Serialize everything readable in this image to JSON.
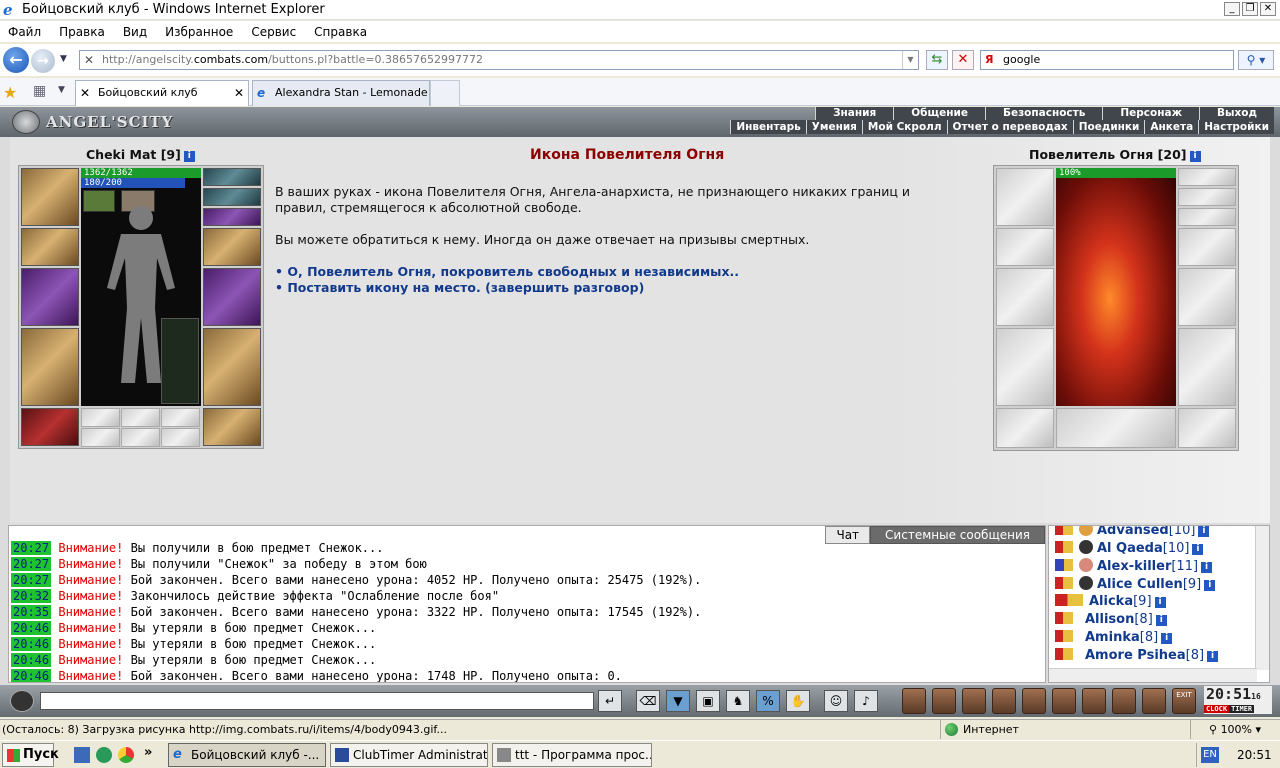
{
  "window": {
    "title": "Бойцовский клуб - Windows Internet Explorer"
  },
  "menu": [
    "Файл",
    "Правка",
    "Вид",
    "Избранное",
    "Сервис",
    "Справка"
  ],
  "address": {
    "url_prefix": "http://angelscity.",
    "url_host": "combats.com",
    "url_suffix": "/buttons.pl?battle=0.38657652997772",
    "search_value": "google"
  },
  "tabs": [
    {
      "label": "Бойцовский клуб"
    },
    {
      "label": "Alexandra Stan - Lemonade ..."
    }
  ],
  "game": {
    "logo": "ANGEL'SCITY",
    "top_menu": [
      "Знания",
      "Общение",
      "Безопасность",
      "Персонаж",
      "Выход"
    ],
    "sub_menu": [
      "Инвентарь",
      "Умения",
      "Мой Скролл",
      "Отчет о переводах",
      "Поединки",
      "Анкета",
      "Настройки"
    ],
    "player": {
      "name": "Cheki Mat",
      "level": "[9]",
      "hp": "1362/1362",
      "mana": "180/200"
    },
    "dialog": {
      "title": "Икона Повелителя Огня",
      "para1": "В ваших руках - икона Повелителя Огня, Ангела-анархиста, не признающего никаких границ и правил, стремящегося к абсолютной свободе.",
      "para2": "Вы можете обратиться к нему. Иногда он даже отвечает на призывы смертных.",
      "option1": "• О, Повелитель Огня, покровитель свободных и независимых..",
      "option2": "• Поставить икону на место. (завершить разговор)"
    },
    "npc": {
      "name": "Повелитель Огня",
      "level": "[20]",
      "hp": "100%"
    },
    "chat": {
      "tab_chat": "Чат",
      "tab_system": "Системные сообщения",
      "lines": [
        {
          "time": "20:27",
          "warn": "Внимание!",
          "text": " Вы получили в бою предмет Снежок..."
        },
        {
          "time": "20:27",
          "warn": "Внимание!",
          "text": " Вы получили \"Снежок\" за победу в этом бою"
        },
        {
          "time": "20:27",
          "warn": "Внимание!",
          "text": " Бой закончен. Всего вами нанесено урона: 4052 HP. Получено опыта: 25475 (192%)."
        },
        {
          "time": "20:32",
          "warn": "Внимание!",
          "text": " Закончилось действие эффекта \"Ослабление после боя\""
        },
        {
          "time": "20:35",
          "warn": "Внимание!",
          "text": " Бой закончен. Всего вами нанесено урона: 3322 HP. Получено опыта: 17545 (192%)."
        },
        {
          "time": "20:46",
          "warn": "Внимание!",
          "text": " Вы утеряли в бою предмет Снежок..."
        },
        {
          "time": "20:46",
          "warn": "Внимание!",
          "text": " Вы утеряли в бою предмет Снежок..."
        },
        {
          "time": "20:46",
          "warn": "Внимание!",
          "text": " Вы утеряли в бою предмет Снежок..."
        },
        {
          "time": "20:46",
          "warn": "Внимание!",
          "text": " Бой закончен. Всего вами нанесено урона: 1748 HP. Получено опыта: 0."
        }
      ]
    },
    "users": [
      {
        "name": "Advansed",
        "level": "[10]"
      },
      {
        "name": "Al Qaeda",
        "level": "[10]"
      },
      {
        "name": "Alex-killer",
        "level": "[11]"
      },
      {
        "name": "Alice Cullen",
        "level": "[9]"
      },
      {
        "name": "Alicka",
        "level": "[9]"
      },
      {
        "name": "Allison",
        "level": "[8]"
      },
      {
        "name": "Aminka",
        "level": "[8]"
      },
      {
        "name": "Amore Psihea",
        "level": "[8]"
      }
    ],
    "clock": {
      "time": "20:51",
      "seconds": "16",
      "label_a": "CLOCK",
      "label_b": "TIMER",
      "exit_label": "EXIT"
    }
  },
  "status": {
    "text": "(Осталось: 8) Загрузка рисунка http://img.combats.ru/i/items/4/body0943.gif...",
    "zone": "Интернет",
    "zoom": "100%"
  },
  "taskbar": {
    "start": "Пуск",
    "tasks": [
      "Бойцовский клуб -...",
      "ClubTimer Administrat...",
      "ttt - Программа прос..."
    ],
    "lang": "EN",
    "time": "20:51"
  }
}
